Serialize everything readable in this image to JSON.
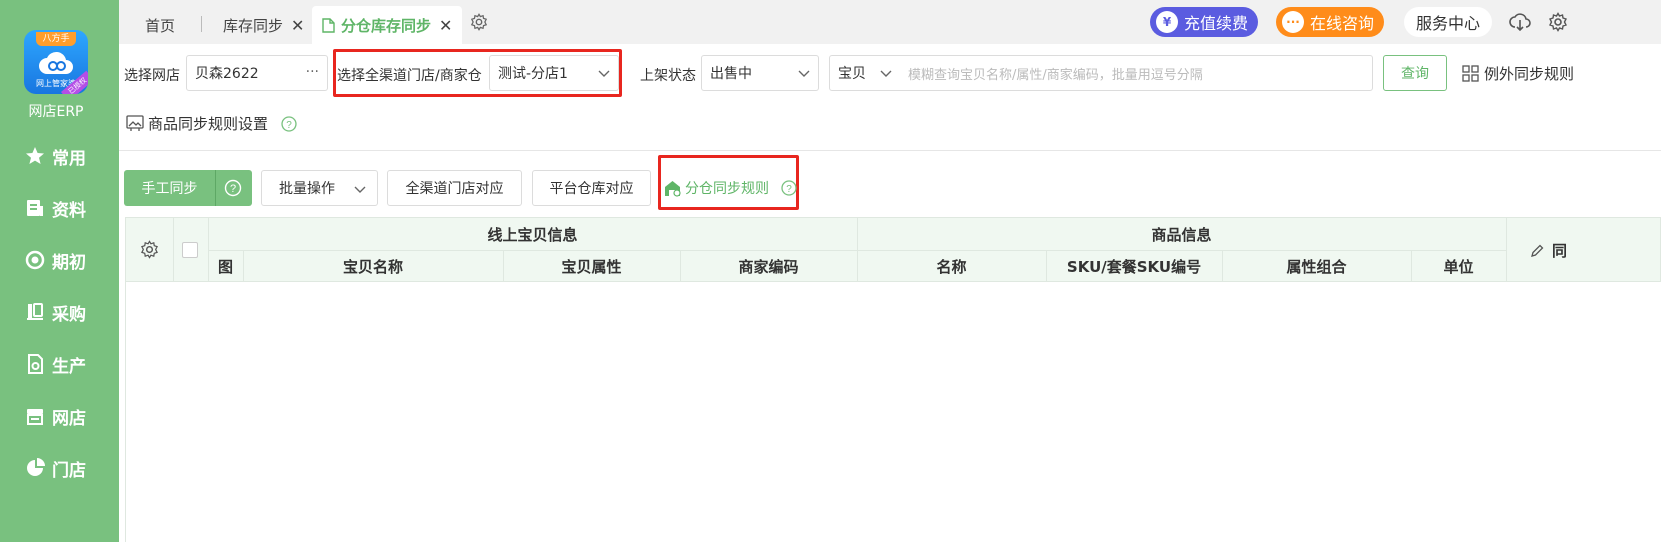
{
  "app": {
    "brand": "网店ERP",
    "logo_top": "八方手",
    "logo_sub": "网上管家婆",
    "logo_ribbon": "已授权"
  },
  "sidebar": {
    "items": [
      {
        "label": "常用",
        "icon": "star-icon"
      },
      {
        "label": "资料",
        "icon": "document-icon"
      },
      {
        "label": "期初",
        "icon": "target-icon"
      },
      {
        "label": "采购",
        "icon": "purchase-icon"
      },
      {
        "label": "生产",
        "icon": "production-icon"
      },
      {
        "label": "网店",
        "icon": "shop-icon"
      },
      {
        "label": "门店",
        "icon": "pie-icon"
      }
    ]
  },
  "tabs": [
    {
      "label": "首页"
    },
    {
      "label": "库存同步",
      "close": "✕"
    },
    {
      "label": "分仓库存同步",
      "close": "✕"
    }
  ],
  "header": {
    "recharge": "充值续费",
    "consult": "在线咨询",
    "service": "服务中心",
    "colors": {
      "recharge_bg": "#5b5ce0",
      "consult_bg": "#ff8c1a",
      "accent": "#5fb567",
      "highlight": "#e8261f"
    }
  },
  "filters": {
    "shop_label": "选择网店",
    "shop_value": "贝森2622",
    "shop_more": "···",
    "channel_label": "选择全渠道门店/商家仓",
    "channel_value": "测试-分店1",
    "status_label": "上架状态",
    "status_value": "出售中",
    "search_type": "宝贝",
    "search_placeholder": "模糊查询宝贝名称/属性/商家编码，批量用逗号分隔",
    "query_button": "查询",
    "exception_rule": "例外同步规则",
    "product_rule": "商品同步规则设置"
  },
  "toolbar": {
    "manual_sync": "手工同步",
    "batch_ops": "批量操作",
    "channel_map": "全渠道门店对应",
    "platform_map": "平台仓库对应",
    "warehouse_rule": "分仓同步规则"
  },
  "table": {
    "group_online": "线上宝贝信息",
    "group_goods": "商品信息",
    "group_sync": "同",
    "columns": [
      "图",
      "宝贝名称",
      "宝贝属性",
      "商家编码",
      "名称",
      "SKU/套餐SKU编号",
      "属性组合",
      "单位"
    ]
  }
}
